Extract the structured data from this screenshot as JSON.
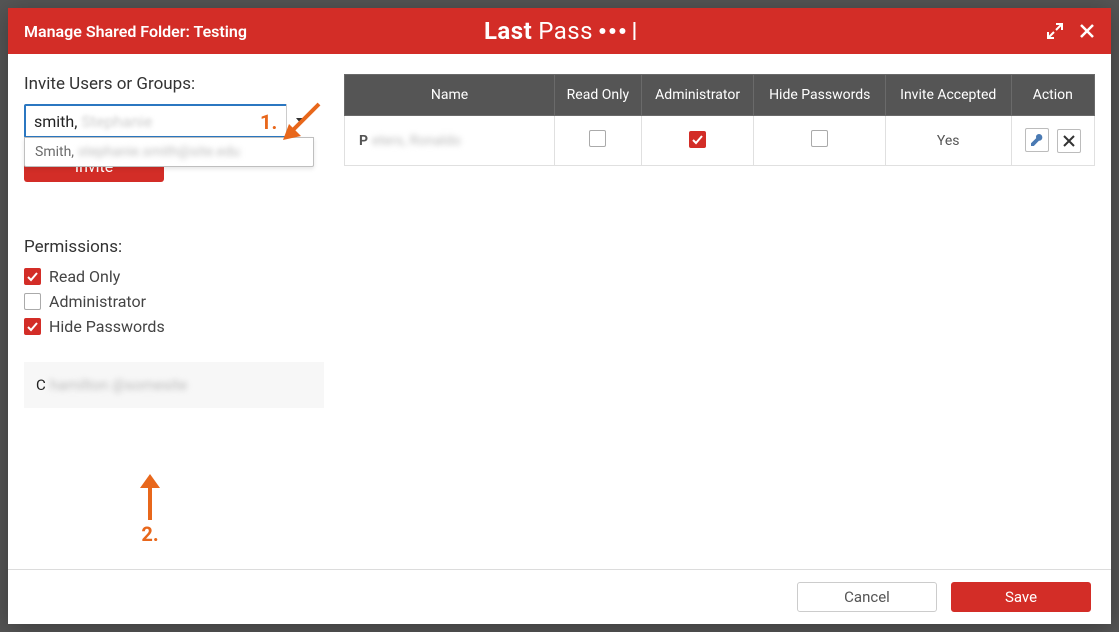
{
  "header": {
    "title": "Manage Shared Folder: Testing",
    "brand_left": "Last",
    "brand_right": "Pass"
  },
  "left_panel": {
    "invite_label": "Invite Users or Groups:",
    "input_typed": "smith,",
    "input_suggest": "Stephanie",
    "dropdown_option_prefix": "Smith,",
    "dropdown_option_rest": "stephanie.smith@site.edu",
    "invite_button": "Invite",
    "permissions_label": "Permissions:",
    "perm_read_only": {
      "label": "Read Only",
      "checked": true
    },
    "perm_admin": {
      "label": "Administrator",
      "checked": false
    },
    "perm_hide_pw": {
      "label": "Hide Passwords",
      "checked": true
    },
    "added_user_initial": "C",
    "added_user_rest": "hamilton @somesite"
  },
  "annotations": {
    "one": "1.",
    "two": "2."
  },
  "table": {
    "columns": [
      "Name",
      "Read Only",
      "Administrator",
      "Hide Passwords",
      "Invite Accepted",
      "Action"
    ],
    "rows": [
      {
        "name_initial": "P",
        "name_rest": "eters, Ronaldo",
        "read_only": false,
        "administrator": true,
        "hide_passwords": false,
        "invite_accepted": "Yes"
      }
    ]
  },
  "footer": {
    "cancel": "Cancel",
    "save": "Save"
  }
}
